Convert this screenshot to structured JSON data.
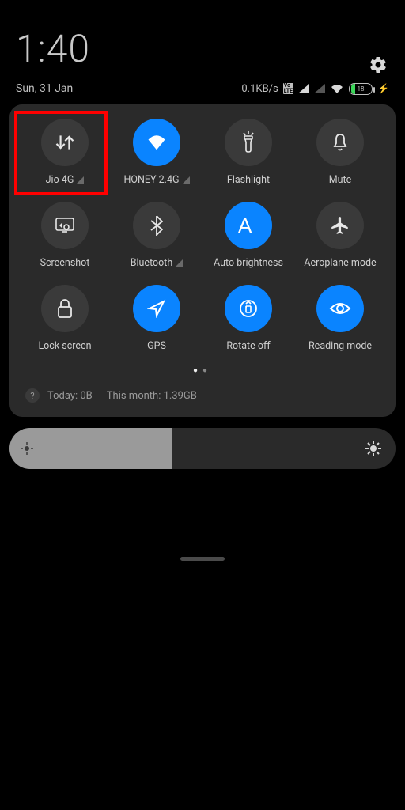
{
  "status": {
    "time": "1:40",
    "date": "Sun, 31 Jan",
    "net_speed": "0.1KB/s",
    "battery_pct": "18",
    "volte": "Vo LTE"
  },
  "tiles": [
    {
      "name": "mobile-data",
      "label": "Jio 4G",
      "active": false,
      "signal": true
    },
    {
      "name": "wifi",
      "label": "HONEY 2.4G",
      "active": true,
      "signal": true
    },
    {
      "name": "flashlight",
      "label": "Flashlight",
      "active": false,
      "signal": false
    },
    {
      "name": "mute",
      "label": "Mute",
      "active": false,
      "signal": false
    },
    {
      "name": "screenshot",
      "label": "Screenshot",
      "active": false,
      "signal": false
    },
    {
      "name": "bluetooth",
      "label": "Bluetooth",
      "active": false,
      "signal": true
    },
    {
      "name": "autobright",
      "label": "Auto brightness",
      "active": true,
      "signal": false
    },
    {
      "name": "airplane",
      "label": "Aeroplane mode",
      "active": false,
      "signal": false
    },
    {
      "name": "lockscreen",
      "label": "Lock screen",
      "active": false,
      "signal": false
    },
    {
      "name": "gps",
      "label": "GPS",
      "active": true,
      "signal": false
    },
    {
      "name": "rotate",
      "label": "Rotate off",
      "active": true,
      "signal": false
    },
    {
      "name": "reading",
      "label": "Reading mode",
      "active": true,
      "signal": false
    }
  ],
  "usage": {
    "today_label": "Today: 0B",
    "month_label": "This month: 1.39GB"
  },
  "brightness": {
    "percent": 42
  },
  "colors": {
    "accent_on": "#0a84ff",
    "accent_off": "#3a3a3a",
    "highlight": "#ff0000"
  },
  "highlight_tile_index": 0
}
